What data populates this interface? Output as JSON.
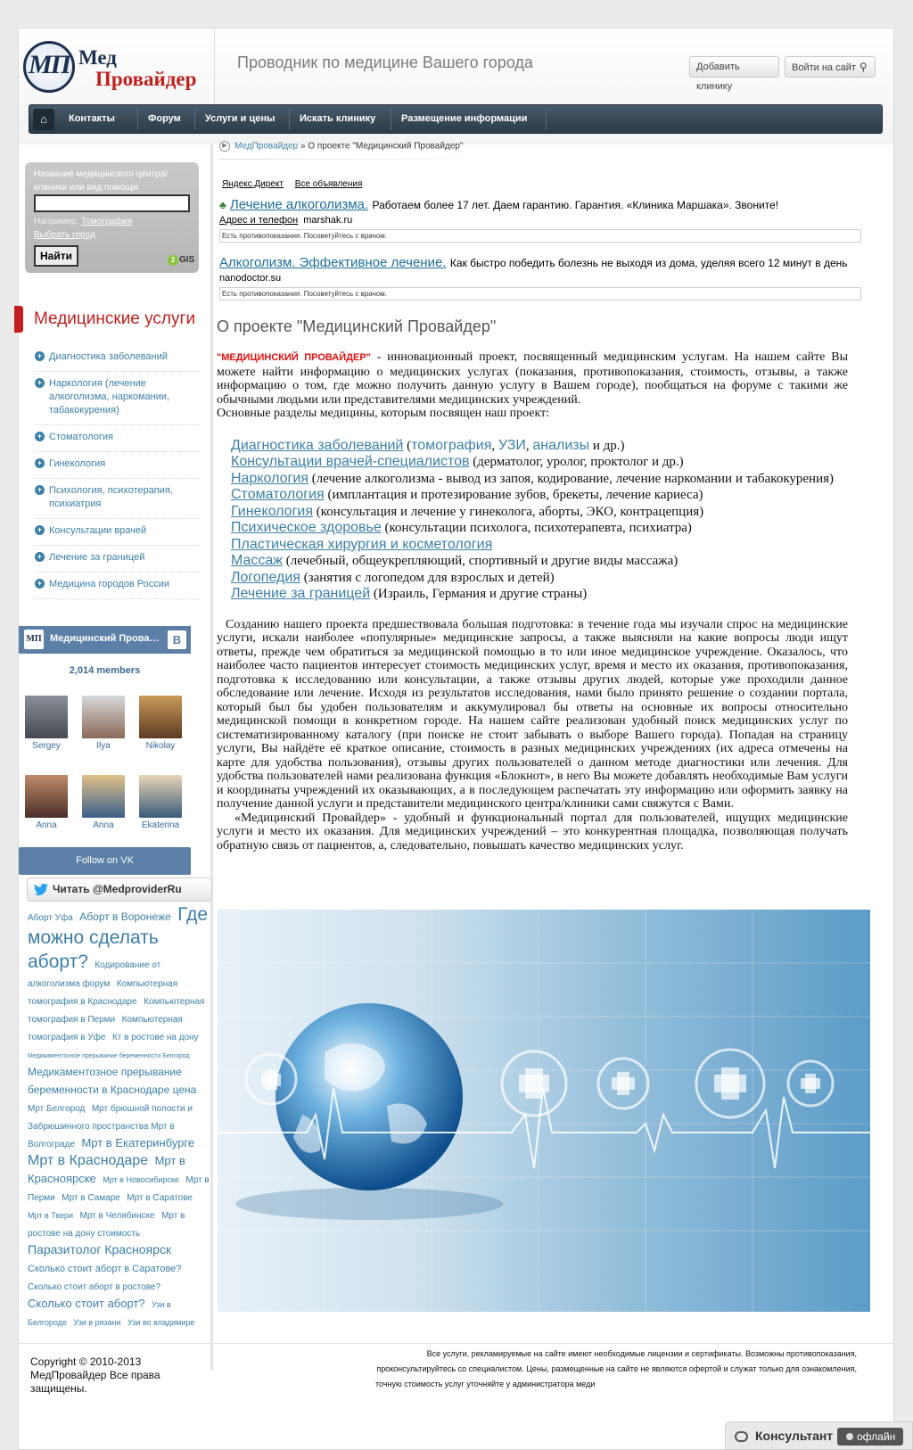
{
  "header": {
    "logo_mark": "МП",
    "logo_line1": "Мед",
    "logo_line2": "Провайдер",
    "tagline": "Проводник по медицине Вашего города",
    "add_clinic": "Добавить клинику",
    "login": "Войти на сайт"
  },
  "nav": {
    "items": [
      "Контакты",
      "Форум",
      "Услуги и цены",
      "Искать клинику",
      "Размещение информации"
    ]
  },
  "search": {
    "label": "Название медицинского центра/клиники или вид помощи.",
    "value": "",
    "example_prefix": "Например,",
    "example_link": "Томография",
    "city": "Выбрать город",
    "button": "Найти",
    "provider": "GIS",
    "provider_mark": "2"
  },
  "services": {
    "title": "Медицинские услуги",
    "items": [
      "Диагностика заболеваний",
      "Наркология (лечение алкоголизма, наркомании, табакокурения)",
      "Стоматология",
      "Гинекология",
      "Психология, психотерапия, психиатрия",
      "Консультации врачей",
      "Лечение за границей",
      "Медицина городов России"
    ]
  },
  "vk": {
    "avatar_label": "МП",
    "group": "Медицинский Провайдер",
    "logo": "B",
    "members": "2,014 members",
    "people": [
      "Sergey",
      "Ilya",
      "Nikolay",
      "Anna",
      "Anna",
      "Ekaterina"
    ],
    "follow": "Follow on VK"
  },
  "twitter": {
    "label": "Читать @MedproviderRu"
  },
  "tags": [
    {
      "t": "Аборт Уфа",
      "s": 10
    },
    {
      "t": "Аборт в Воронеже",
      "s": 12
    },
    {
      "t": "Где можно сделать аборт?",
      "s": 21
    },
    {
      "t": "Кодирование от алкоголизма форум",
      "s": 10
    },
    {
      "t": "Компьютерная томография в Краснодаре",
      "s": 10
    },
    {
      "t": "Компьютерная томография в Перми",
      "s": 10
    },
    {
      "t": "Компьютерная томография в Уфе",
      "s": 10
    },
    {
      "t": "Кт в ростове на дону",
      "s": 10
    },
    {
      "t": "Медикаментозное прерывание беременности Белгород",
      "s": 7
    },
    {
      "t": "Медикаментозное прерывание беременности в Краснодаре цена",
      "s": 12
    },
    {
      "t": "Мрт Белгород",
      "s": 10
    },
    {
      "t": "Мрт брюшной полости и Забрюшинного пространства Мрт в Волгограде",
      "s": 10
    },
    {
      "t": "Мрт в Екатеринбурге",
      "s": 13
    },
    {
      "t": "Мрт в Краснодаре",
      "s": 16
    },
    {
      "t": "Мрт в Красноярске",
      "s": 13
    },
    {
      "t": "Мрт в Новосибирске",
      "s": 9
    },
    {
      "t": "Мрт в Перми",
      "s": 10
    },
    {
      "t": "Мрт в Самаре",
      "s": 10
    },
    {
      "t": "Мрт в Саратове",
      "s": 10
    },
    {
      "t": "Мрт в Твери",
      "s": 9
    },
    {
      "t": "Мрт в Челябинске",
      "s": 10
    },
    {
      "t": "Мрт в ростове на дону стоимость",
      "s": 10
    },
    {
      "t": "Паразитолог Красноярск",
      "s": 14
    },
    {
      "t": "Сколько стоит аборт в Саратове?",
      "s": 11
    },
    {
      "t": "Сколько стоит аборт в ростове?",
      "s": 10
    },
    {
      "t": "Сколько стоит аборт?",
      "s": 13
    },
    {
      "t": "Узи в Белгороде",
      "s": 9
    },
    {
      "t": "Узи в рязани",
      "s": 9
    },
    {
      "t": "Узи во владимире",
      "s": 9
    }
  ],
  "breadcrumb": {
    "home": "МедПровайдер",
    "sep": " » ",
    "current": "О проекте \"Медицинский Провайдер\""
  },
  "ads": {
    "yandex": "Яндекс.Директ",
    "all": "Все объявления",
    "ad1": {
      "title": "Лечение алкоголизма.",
      "text": "Работаем более 17 лет. Даем гарантию. Гарантия. «Клиника Маршака». Звоните!",
      "contact": "Адрес и телефон",
      "domain": "marshak.ru",
      "note": "Есть противопоказания. Посоветуйтесь с врачом."
    },
    "ad2": {
      "title": "Алкоголизм. Эффективное лечение.",
      "text": "Как быстро победить болезнь не выходя из дома, уделяя всего 12 минут в день",
      "domain": "nanodoctor.su",
      "note": "Есть противопоказания. Посоветуйтесь с врачом."
    }
  },
  "article": {
    "title": "О проекте \"Медицинский Провайдер\"",
    "brand": "\"МЕДИЦИНСКИЙ ПРОВАЙДЕР\"",
    "intro": " - инновационный проект, посвященный медицинским услугам. На нашем сайте Вы можете найти информацию о медицинских услугах (показания, противопоказания, стоимость, отзывы, а также информацию о том, где можно получить данную услугу в Вашем городе), пообщаться на форуме с такими же обычными людьми или представителями медицинских учреждений.",
    "sections_intro": " Основные разделы медицины, которым посвящен наш проект:",
    "sections": [
      {
        "link": "Диагностика заболеваний",
        "sub": [
          "томография",
          "УЗИ",
          "анализы"
        ],
        "rest": " и др.)"
      },
      {
        "link": "Консультации врачей-специалистов",
        "rest": " (дерматолог, уролог, проктолог и др.)"
      },
      {
        "link": "Наркология",
        "rest": " (лечение алкоголизма - вывод из запоя, кодирование, лечение наркомании и табакокурения)"
      },
      {
        "link": "Стоматология",
        "rest": " (имплантация и протезирование зубов, брекеты, лечение кариеса)"
      },
      {
        "link": "Гинекология",
        "rest": " (консультация и лечение у гинеколога, аборты, ЭКО, контрацепция)"
      },
      {
        "link": "Психическое здоровье",
        "rest": " (консультации психолога, психотерапевта, психиатра)"
      },
      {
        "link": "Пластическая хирургия и косметология",
        "rest": ""
      },
      {
        "link": "Массаж",
        "rest": " (лечебный, общеукрепляющий, спортивный и другие виды массажа)"
      },
      {
        "link": "Логопедия",
        "rest": " (занятия с логопедом для взрослых и детей)"
      },
      {
        "link": "Лечение за границей",
        "rest": " (Израиль, Германия и другие страны)"
      }
    ],
    "p2": "Созданию нашего проекта предшествовала большая подготовка: в течение года мы изучали  спрос на медицинские услуги, искали наиболее «популярные» медицинские запросы, а также выясняли на какие вопросы люди ищут ответы, прежде чем обратиться за медицинской помощью в то или иное медицинское учреждение. Оказалось, что наиболее часто пациентов интересует стоимость медицинских услуг, время и место  их оказания, противопоказания, подготовка к исследованию или консультации, а также отзывы других людей, которые уже проходили данное обследование или лечение. Исходя из результатов исследования, нами было принято решение о создании портала, который был бы удобен пользователям и аккумулировал бы ответы на основные их вопросы относительно медицинской помощи в конкретном городе. На нашем сайте реализован удобный поиск медицинских услуг по систематизированному каталогу (при поиске не стоит забывать о выборе Вашего города). Попадая на страницу услуги, Вы найдёте её краткое описание, стоимость в разных медицинских учреждениях (их адреса отмечены на карте для удобства пользования), отзывы других пользователей о данном методе диагностики или лечения. Для удобства пользователей нами реализована функция «Блокнот», в него Вы можете добавлять необходимые Вам услуги и координаты учреждений их оказывающих, а в последующем распечатать эту информацию или оформить заявку на получение данной услуги и представители медицинского центра/клиники сами свяжутся с Вами.",
    "p3": "«Медицинский Провайдер» - удобный и функциональный портал для пользователей, ищущих медицинские услуги и место их оказания. Для медицинских учреждений – это конкурентная площадка, позволяющая получать обратную связь от пациентов, а, следовательно, повышать качество медицинских услуг."
  },
  "footer": {
    "copyright": "Copyright © 2010-2013 МедПровайдер Все права защищены.",
    "disclaimer1": "Все услуги, рекламируемые на сайте имеют необходимые лицензии и сертификаты. Возможны противопоказания,",
    "disclaimer2": "проконсультируйтесь со специалистом. Цены, размещенные на сайте не являются офертой и служат только для ознакомления,",
    "disclaimer3": "точную стоимость услуг уточняйте у администратора меди"
  },
  "consultant": {
    "label": "Консультант",
    "status": "офлайн"
  },
  "colors": {
    "accent_red": "#c0201e",
    "link_blue": "#3b7fa6",
    "nav_dark": "#2c3b48",
    "vk_blue": "#5b7fa6"
  }
}
